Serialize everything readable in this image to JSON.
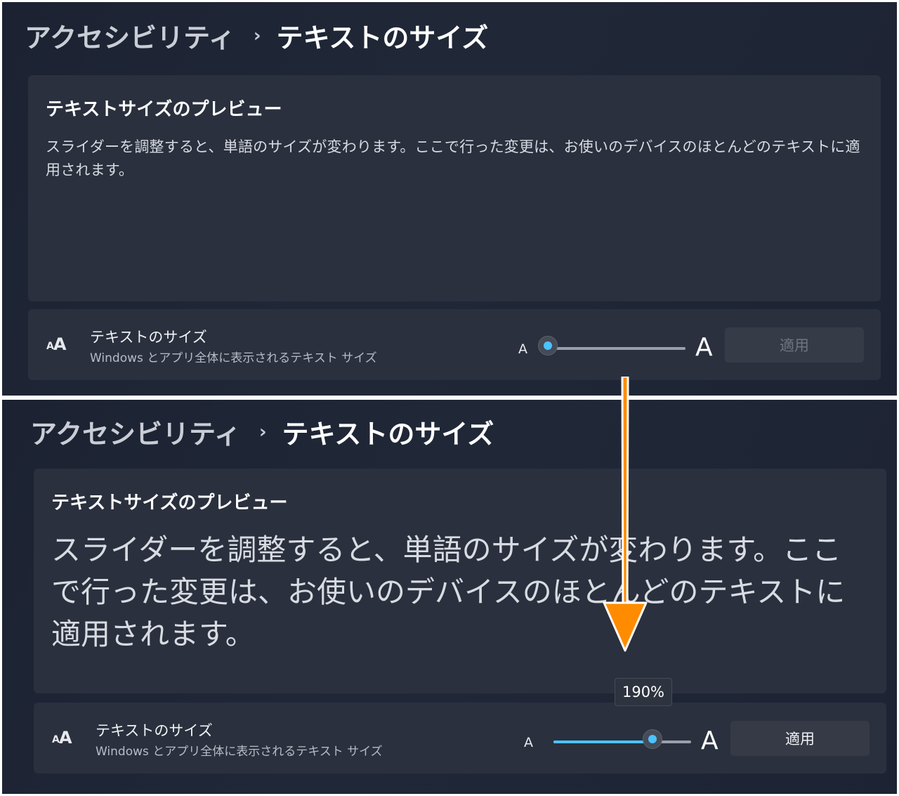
{
  "breadcrumb": {
    "parent": "アクセシビリティ",
    "separator": "›",
    "current": "テキストのサイズ"
  },
  "preview": {
    "title": "テキストサイズのプレビュー",
    "text": "スライダーを調整すると、単語のサイズが変わります。ここで行った変更は、お使いのデバイスのほとんどのテキストに適用されます。"
  },
  "setting": {
    "icon": "text-size-icon",
    "icon_small": "A",
    "icon_large": "A",
    "title": "テキストのサイズ",
    "subtitle": "Windows とアプリ全体に表示されるテキスト サイズ",
    "slider_min_label": "A",
    "slider_max_label": "A",
    "apply_label": "適用"
  },
  "states": {
    "before": {
      "slider_fraction": 0.0,
      "apply_enabled": false
    },
    "after": {
      "slider_fraction": 0.72,
      "apply_enabled": true,
      "tooltip": "190%"
    }
  },
  "colors": {
    "accent": "#4cc2ff",
    "annotation_arrow": "#ff8c00"
  }
}
